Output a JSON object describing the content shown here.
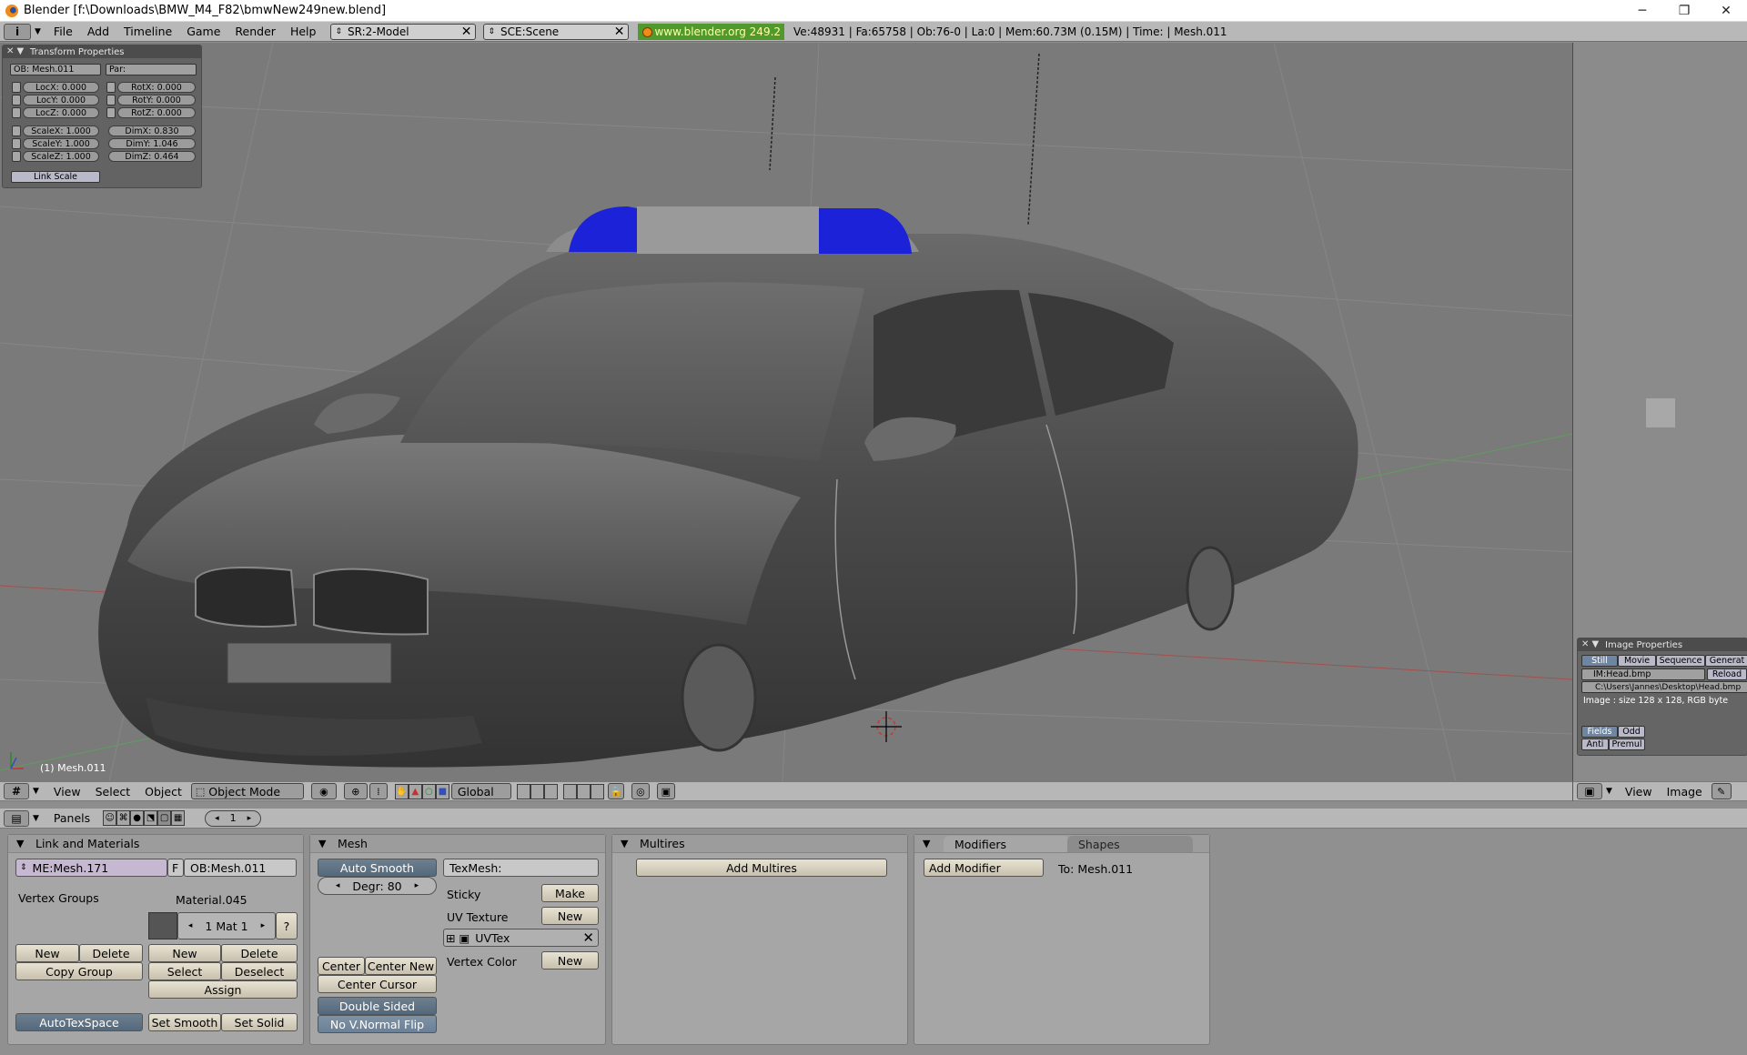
{
  "window": {
    "title": "Blender [f:\\Downloads\\BMW_M4_F82\\bmwNew249new.blend]",
    "controls": {
      "minimize": "─",
      "restore": "❐",
      "close": "✕"
    }
  },
  "topbar": {
    "menus": [
      "File",
      "Add",
      "Timeline",
      "Game",
      "Render",
      "Help"
    ],
    "screen": "SR:2-Model",
    "scene": "SCE:Scene",
    "site": "www.blender.org 249.2",
    "stats": "Ve:48931 | Fa:65758 | Ob:76-0 | La:0  | Mem:60.73M (0.15M)  | Time: | Mesh.011"
  },
  "transform": {
    "title": "Transform Properties",
    "ob": "OB: Mesh.011",
    "par": "Par:",
    "loc": [
      "LocX: 0.000",
      "LocY: 0.000",
      "LocZ: 0.000"
    ],
    "rot": [
      "RotX: 0.000",
      "RotY: 0.000",
      "RotZ: 0.000"
    ],
    "scale": [
      "ScaleX: 1.000",
      "ScaleY: 1.000",
      "ScaleZ: 1.000"
    ],
    "dim": [
      "DimX: 0.830",
      "DimY: 1.046",
      "DimZ: 0.464"
    ],
    "link_scale": "Link Scale"
  },
  "viewport": {
    "object_label": "(1) Mesh.011"
  },
  "image_props": {
    "title": "Image Properties",
    "tabs": [
      "Still",
      "Movie",
      "Sequence",
      "Generat"
    ],
    "image": "IM:Head.bmp",
    "reload": "Reload",
    "path": "C:\\Users\\Jannes\\Desktop\\Head.bmp",
    "info": "Image : size 128 x 128, RGB byte",
    "fields": "Fields",
    "odd": "Odd",
    "anti": "Anti",
    "premul": "Premul"
  },
  "view_header": {
    "menus": [
      "View",
      "Select",
      "Object"
    ],
    "mode": "Object Mode",
    "orientation": "Global"
  },
  "image_header": {
    "menus": [
      "View",
      "Image"
    ]
  },
  "panels_header": {
    "label": "Panels",
    "page": "1"
  },
  "link_materials": {
    "title": "Link and Materials",
    "me": "ME:Mesh.171",
    "f": "F",
    "ob": "OB:Mesh.011",
    "vertex_groups": "Vertex Groups",
    "material": "Material.045",
    "mat_slot": "1 Mat 1",
    "question": "?",
    "new_vg": "New",
    "delete_vg": "Delete",
    "copy_group": "Copy Group",
    "new_mat": "New",
    "delete_mat": "Delete",
    "select": "Select",
    "deselect": "Deselect",
    "assign": "Assign",
    "autotexspace": "AutoTexSpace",
    "set_smooth": "Set Smooth",
    "set_solid": "Set Solid"
  },
  "mesh": {
    "title": "Mesh",
    "auto_smooth": "Auto Smooth",
    "degr": "Degr: 80",
    "texmesh": "TexMesh:",
    "sticky": "Sticky",
    "make": "Make",
    "uv_texture": "UV Texture",
    "uv_new": "New",
    "uvtex": "UVTex",
    "vertex_color": "Vertex Color",
    "vc_new": "New",
    "center": "Center",
    "center_new": "Center New",
    "center_cursor": "Center Cursor",
    "double_sided": "Double Sided",
    "no_vnormal_flip": "No V.Normal Flip"
  },
  "multires": {
    "title": "Multires",
    "add": "Add Multires"
  },
  "modifiers": {
    "tab_modifiers": "Modifiers",
    "tab_shapes": "Shapes",
    "add": "Add Modifier",
    "to": "To: Mesh.011"
  }
}
